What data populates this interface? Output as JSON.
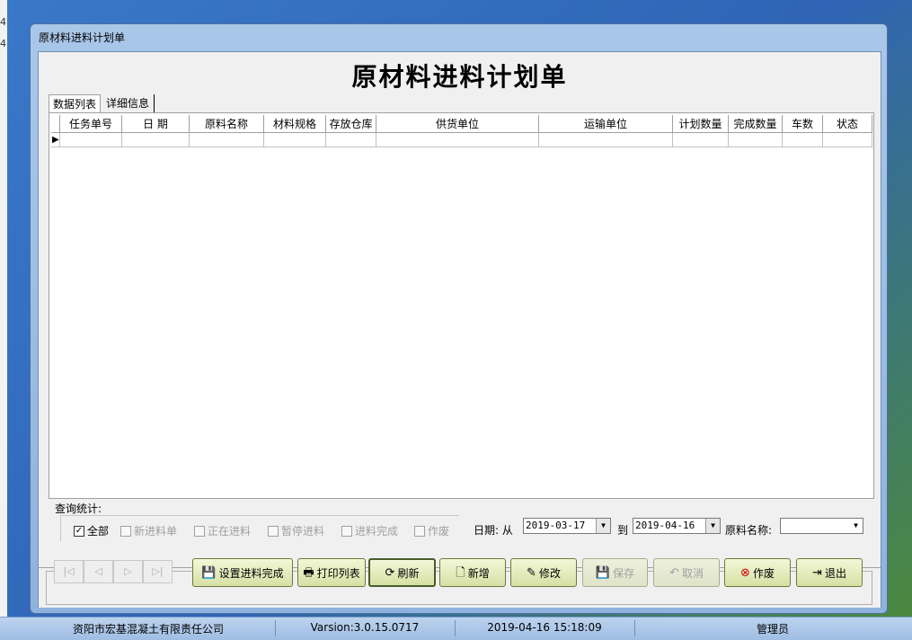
{
  "window": {
    "title": "原材料进料计划单"
  },
  "page": {
    "heading": "原材料进料计划单"
  },
  "tabs": [
    {
      "label": "数据列表",
      "active": true
    },
    {
      "label": "详细信息",
      "active": false
    }
  ],
  "grid": {
    "columns": [
      "任务单号",
      "日 期",
      "原料名称",
      "材料规格",
      "存放仓库",
      "供货单位",
      "运输单位",
      "计划数量",
      "完成数量",
      "车数",
      "状态"
    ],
    "rows": []
  },
  "stats": {
    "label": "查询统计:",
    "options": [
      {
        "label": "全部",
        "checked": true
      },
      {
        "label": "新进料单",
        "checked": false
      },
      {
        "label": "正在进料",
        "checked": false
      },
      {
        "label": "暂停进料",
        "checked": false
      },
      {
        "label": "进料完成",
        "checked": false
      },
      {
        "label": "作废",
        "checked": false
      }
    ]
  },
  "filters": {
    "date_label": "日期: 从",
    "date_from": "2019-03-17",
    "to_label": "到",
    "date_to": "2019-04-16",
    "material_label": "原料名称:",
    "material_value": ""
  },
  "toolbar": {
    "nav": [
      "|◁",
      "◁",
      "▷",
      "▷|"
    ],
    "buttons": [
      {
        "label": "设置进料完成",
        "icon": "save-icon",
        "enabled": true
      },
      {
        "label": "打印列表",
        "icon": "printer-icon",
        "enabled": true
      },
      {
        "label": "刷新",
        "icon": "refresh-icon",
        "enabled": true
      },
      {
        "label": "新增",
        "icon": "new-document-icon",
        "enabled": true
      },
      {
        "label": "修改",
        "icon": "edit-icon",
        "enabled": true
      },
      {
        "label": "保存",
        "icon": "save-icon",
        "enabled": false
      },
      {
        "label": "取消",
        "icon": "undo-icon",
        "enabled": false
      },
      {
        "label": "作废",
        "icon": "cancel-icon",
        "enabled": true
      },
      {
        "label": "退出",
        "icon": "exit-icon",
        "enabled": true
      }
    ]
  },
  "statusbar": {
    "company": "资阳市宏基混凝土有限责任公司",
    "version": "Varsion:3.0.15.0717",
    "datetime": "2019-04-16 15:18:09",
    "user": "管理员"
  }
}
